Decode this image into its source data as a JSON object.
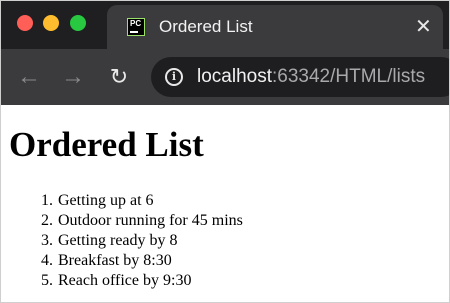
{
  "window": {
    "tab_title": "Ordered List",
    "tab_favicon_text": "PC",
    "favicon_icon": "pycharm-icon",
    "close_glyph": "✕"
  },
  "toolbar": {
    "back_glyph": "←",
    "forward_glyph": "→",
    "reload_glyph": "↻",
    "info_glyph": "i",
    "url_host": "localhost",
    "url_rest": ":63342/HTML/lists"
  },
  "page": {
    "heading": "Ordered List",
    "items": [
      {
        "number": "1.",
        "text": "Getting up at 6"
      },
      {
        "number": "2.",
        "text": "Outdoor running for 45 mins"
      },
      {
        "number": "3.",
        "text": "Getting ready by 8"
      },
      {
        "number": "4.",
        "text": "Breakfast by 8:30"
      },
      {
        "number": "5.",
        "text": "Reach office by 9:30"
      }
    ]
  },
  "colors": {
    "tabstrip_bg": "#1f1f21",
    "toolbar_bg": "#3b3b3d",
    "close_red": "#ff5f57",
    "minimize_yellow": "#febc2e",
    "maximize_green": "#28c840"
  }
}
